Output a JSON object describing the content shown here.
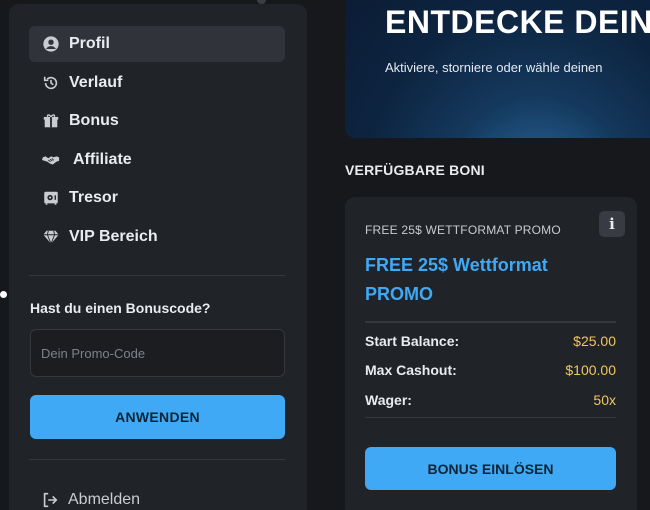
{
  "sidebar": {
    "items": [
      {
        "label": "Profil",
        "icon": "user-circle-icon",
        "active": true
      },
      {
        "label": "Verlauf",
        "icon": "history-icon"
      },
      {
        "label": "Bonus",
        "icon": "gift-icon"
      },
      {
        "label": "Affiliate",
        "icon": "handshake-icon"
      },
      {
        "label": "Tresor",
        "icon": "safe-icon"
      },
      {
        "label": "VIP Bereich",
        "icon": "diamond-icon"
      }
    ],
    "promo": {
      "title": "Hast du einen Bonuscode?",
      "placeholder": "Dein Promo-Code",
      "apply_label": "ANWENDEN"
    },
    "logout_label": "Abmelden"
  },
  "hero": {
    "title": "ENTDECKE DEINE",
    "subtitle": "Aktiviere, storniere oder wähle deinen"
  },
  "section_title": "VERFÜGBARE BONI",
  "bonus_card": {
    "small_title": "FREE 25$ WETTFORMAT PROMO",
    "title": "FREE 25$ Wettformat PROMO",
    "info_label": "i",
    "stats": [
      {
        "label": "Start Balance:",
        "value": "$25.00"
      },
      {
        "label": "Max Cashout:",
        "value": "$100.00"
      },
      {
        "label": "Wager:",
        "value": "50x"
      }
    ],
    "redeem_label": "BONUS EINLÖSEN"
  },
  "colors": {
    "accent": "#3fa9f5",
    "value": "#f0c75a",
    "panel": "#202327",
    "background": "#16181c"
  }
}
